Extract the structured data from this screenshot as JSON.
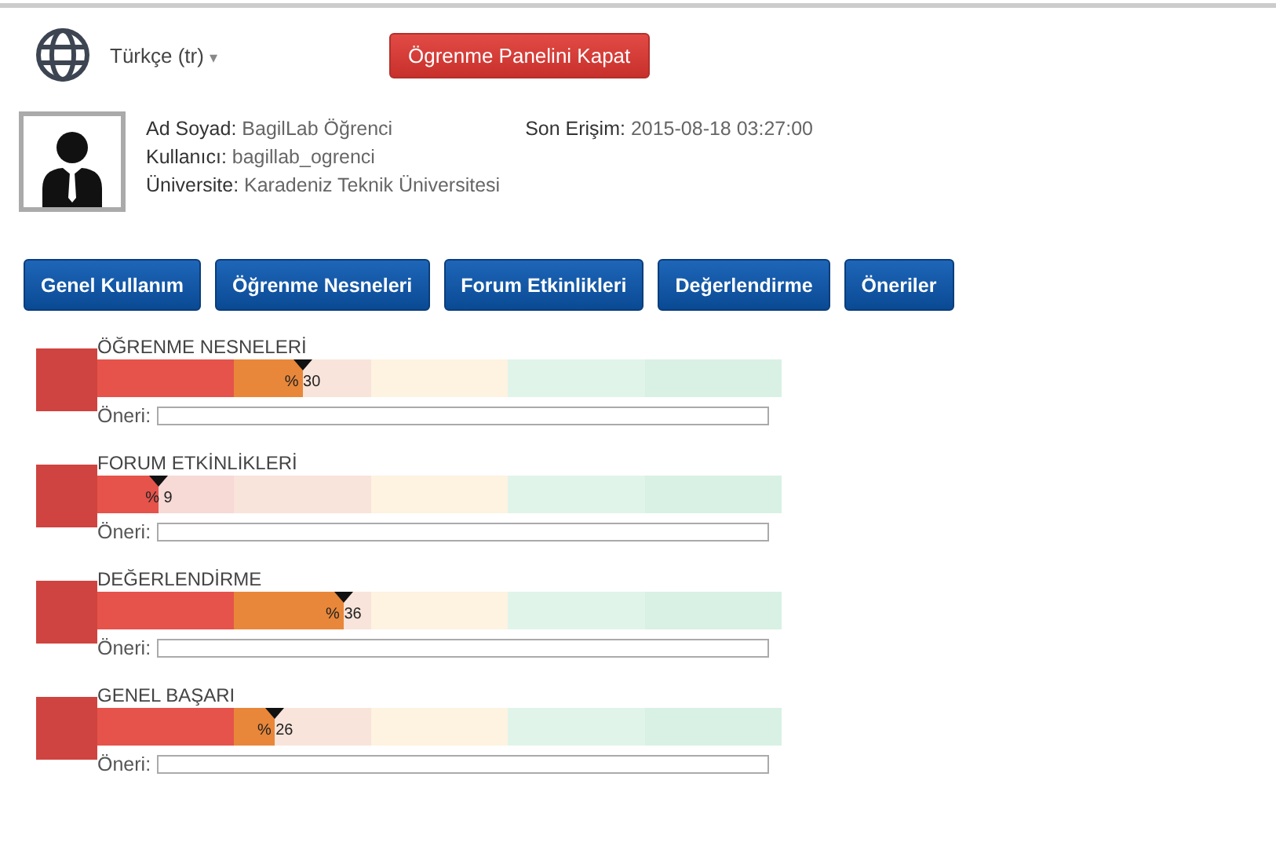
{
  "language": {
    "label": "Türkçe (tr)",
    "caret": "▾"
  },
  "close_button": "Ögrenme Panelini Kapat",
  "profile": {
    "fields": [
      {
        "label": "Ad Soyad:",
        "value": "BagilLab Öğrenci"
      },
      {
        "label": "Kullanıcı:",
        "value": "bagillab_ogrenci"
      },
      {
        "label": "Üniversite:",
        "value": "Karadeniz Teknik Üniversitesi"
      }
    ],
    "last_access": {
      "label": "Son Erişim:",
      "value": "2015-08-18 03:27:00"
    }
  },
  "tabs": [
    "Genel Kullanım",
    "Öğrenme Nesneleri",
    "Forum Etkinlikleri",
    "Değerlendirme",
    "Öneriler"
  ],
  "sections": [
    {
      "title": "ÖĞRENME NESNELERİ",
      "level": 0.3,
      "percent": "% 30",
      "suggestion_label": "Öneri:"
    },
    {
      "title": "FORUM ETKİNLİKLERİ",
      "level": 0.09,
      "percent": "% 9",
      "suggestion_label": "Öneri:"
    },
    {
      "title": "DEĞERLENDİRME",
      "level": 0.36,
      "percent": "% 36",
      "suggestion_label": "Öneri:"
    },
    {
      "title": "GENEL BAŞARI",
      "level": 0.26,
      "percent": "% 26",
      "suggestion_label": "Öneri:"
    }
  ]
}
